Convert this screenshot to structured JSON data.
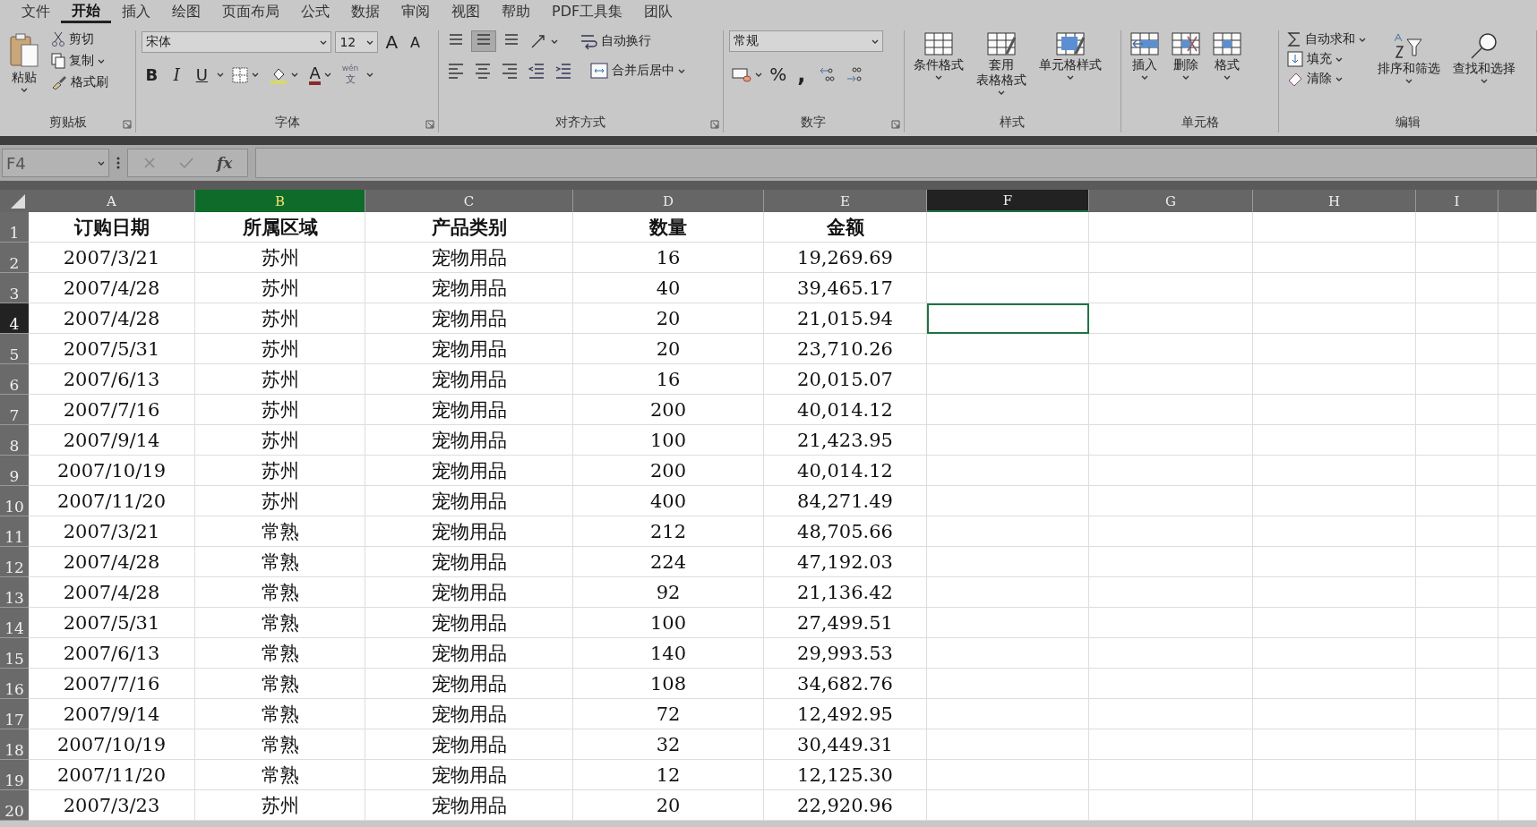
{
  "menu": [
    {
      "label": "文件",
      "selected": false
    },
    {
      "label": "开始",
      "selected": true
    },
    {
      "label": "插入",
      "selected": false
    },
    {
      "label": "绘图",
      "selected": false
    },
    {
      "label": "页面布局",
      "selected": false
    },
    {
      "label": "公式",
      "selected": false
    },
    {
      "label": "数据",
      "selected": false
    },
    {
      "label": "审阅",
      "selected": false
    },
    {
      "label": "视图",
      "selected": false
    },
    {
      "label": "帮助",
      "selected": false
    },
    {
      "label": "PDF工具集",
      "selected": false
    },
    {
      "label": "团队",
      "selected": false
    }
  ],
  "ribbon": {
    "clipboard": {
      "label": "剪贴板",
      "paste": "粘贴",
      "cut": "剪切",
      "copy": "复制",
      "format_painter": "格式刷"
    },
    "font": {
      "label": "字体",
      "font_name": "宋体",
      "font_size": "12",
      "grow": "A",
      "shrink": "A",
      "bold": "B",
      "italic": "I",
      "underline": "U",
      "font_color": "A",
      "phonetic_top": "wén",
      "phonetic_bottom": "文"
    },
    "alignment": {
      "label": "对齐方式",
      "wrap_text": "自动换行",
      "merge_center": "合并后居中"
    },
    "number": {
      "label": "数字",
      "format": "常规",
      "percent": "%",
      "comma": ","
    },
    "styles": {
      "label": "样式",
      "conditional": "条件格式",
      "table_line1": "套用",
      "table_line2": "表格格式",
      "cell_styles": "单元格样式"
    },
    "cells": {
      "label": "单元格",
      "insert": "插入",
      "delete": "删除",
      "format": "格式"
    },
    "editing": {
      "label": "编辑",
      "autosum": "自动求和",
      "fill": "填充",
      "clear": "清除",
      "sort_filter": "排序和筛选",
      "find_select": "查找和选择"
    }
  },
  "formula_bar": {
    "name_box": "F4",
    "fx": "fx"
  },
  "sheet": {
    "columns": [
      {
        "label": "A",
        "selected": false,
        "highlighted": false
      },
      {
        "label": "B",
        "selected": false,
        "highlighted": true
      },
      {
        "label": "C",
        "selected": false,
        "highlighted": false
      },
      {
        "label": "D",
        "selected": false,
        "highlighted": false
      },
      {
        "label": "E",
        "selected": false,
        "highlighted": false
      },
      {
        "label": "F",
        "selected": true,
        "highlighted": false
      },
      {
        "label": "G",
        "selected": false,
        "highlighted": false
      },
      {
        "label": "H",
        "selected": false,
        "highlighted": false
      },
      {
        "label": "I",
        "selected": false,
        "highlighted": false
      }
    ],
    "rows": [
      {
        "header": "1",
        "selected": false,
        "kind": "header",
        "cells": [
          "订购日期",
          "所属区域",
          "产品类别",
          "数量",
          "金额"
        ]
      },
      {
        "header": "2",
        "selected": false,
        "kind": "data",
        "cells": [
          "2007/3/21",
          "苏州",
          "宠物用品",
          "16",
          "19,269.69"
        ]
      },
      {
        "header": "3",
        "selected": false,
        "kind": "data",
        "cells": [
          "2007/4/28",
          "苏州",
          "宠物用品",
          "40",
          "39,465.17"
        ]
      },
      {
        "header": "4",
        "selected": true,
        "kind": "data",
        "cells": [
          "2007/4/28",
          "苏州",
          "宠物用品",
          "20",
          "21,015.94"
        ]
      },
      {
        "header": "5",
        "selected": false,
        "kind": "data",
        "cells": [
          "2007/5/31",
          "苏州",
          "宠物用品",
          "20",
          "23,710.26"
        ]
      },
      {
        "header": "6",
        "selected": false,
        "kind": "data",
        "cells": [
          "2007/6/13",
          "苏州",
          "宠物用品",
          "16",
          "20,015.07"
        ]
      },
      {
        "header": "7",
        "selected": false,
        "kind": "data",
        "cells": [
          "2007/7/16",
          "苏州",
          "宠物用品",
          "200",
          "40,014.12"
        ]
      },
      {
        "header": "8",
        "selected": false,
        "kind": "data",
        "cells": [
          "2007/9/14",
          "苏州",
          "宠物用品",
          "100",
          "21,423.95"
        ]
      },
      {
        "header": "9",
        "selected": false,
        "kind": "data",
        "cells": [
          "2007/10/19",
          "苏州",
          "宠物用品",
          "200",
          "40,014.12"
        ]
      },
      {
        "header": "10",
        "selected": false,
        "kind": "data",
        "cells": [
          "2007/11/20",
          "苏州",
          "宠物用品",
          "400",
          "84,271.49"
        ]
      },
      {
        "header": "11",
        "selected": false,
        "kind": "data",
        "cells": [
          "2007/3/21",
          "常熟",
          "宠物用品",
          "212",
          "48,705.66"
        ]
      },
      {
        "header": "12",
        "selected": false,
        "kind": "data",
        "cells": [
          "2007/4/28",
          "常熟",
          "宠物用品",
          "224",
          "47,192.03"
        ]
      },
      {
        "header": "13",
        "selected": false,
        "kind": "data",
        "cells": [
          "2007/4/28",
          "常熟",
          "宠物用品",
          "92",
          "21,136.42"
        ]
      },
      {
        "header": "14",
        "selected": false,
        "kind": "data",
        "cells": [
          "2007/5/31",
          "常熟",
          "宠物用品",
          "100",
          "27,499.51"
        ]
      },
      {
        "header": "15",
        "selected": false,
        "kind": "data",
        "cells": [
          "2007/6/13",
          "常熟",
          "宠物用品",
          "140",
          "29,993.53"
        ]
      },
      {
        "header": "16",
        "selected": false,
        "kind": "data",
        "cells": [
          "2007/7/16",
          "常熟",
          "宠物用品",
          "108",
          "34,682.76"
        ]
      },
      {
        "header": "17",
        "selected": false,
        "kind": "data",
        "cells": [
          "2007/9/14",
          "常熟",
          "宠物用品",
          "72",
          "12,492.95"
        ]
      },
      {
        "header": "18",
        "selected": false,
        "kind": "data",
        "cells": [
          "2007/10/19",
          "常熟",
          "宠物用品",
          "32",
          "30,449.31"
        ]
      },
      {
        "header": "19",
        "selected": false,
        "kind": "data",
        "cells": [
          "2007/11/20",
          "常熟",
          "宠物用品",
          "12",
          "12,125.30"
        ]
      },
      {
        "header": "20",
        "selected": false,
        "kind": "data",
        "cells": [
          "2007/3/23",
          "苏州",
          "宠物用品",
          "20",
          "22,920.96"
        ]
      }
    ]
  }
}
